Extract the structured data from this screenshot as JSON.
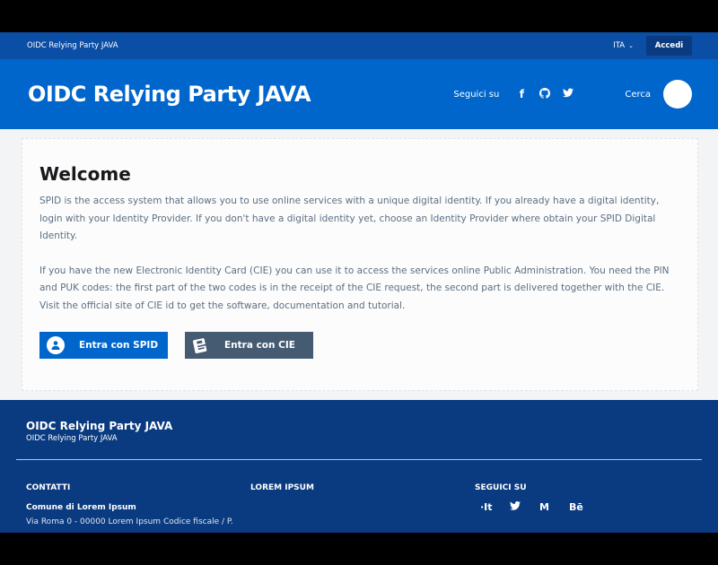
{
  "slim_header": {
    "brand": "OIDC Relying Party JAVA",
    "language": "ITA",
    "login_label": "Accedi"
  },
  "center_header": {
    "title": "OIDC Relying Party JAVA",
    "follow_label": "Seguici su",
    "social_icons": [
      "facebook-icon",
      "github-icon",
      "twitter-icon"
    ],
    "search_label": "Cerca"
  },
  "main": {
    "heading": "Welcome",
    "paragraph_1": "SPID is the access system that allows you to use online services with a unique digital identity. If you already have a digital identity, login with your Identity Provider. If you don't have a digital identity yet, choose an Identity Provider where obtain your SPID Digital Identity.",
    "paragraph_2": "If you have the new Electronic Identity Card (CIE) you can use it to access the services online Public Administration. You need the PIN and PUK codes: the first part of the two codes is in the receipt of the CIE request, the second part is delivered together with the CIE. Visit the official site of CIE id to get the software, documentation and tutorial.",
    "spid_button": "Entra con SPID",
    "cie_button": "Entra con CIE"
  },
  "footer": {
    "title": "OIDC Relying Party JAVA",
    "subtitle": "OIDC Relying Party JAVA",
    "contacts_heading": "CONTATTI",
    "contacts_name": "Comune di Lorem Ipsum",
    "contacts_address": "Via Roma 0 - 00000 Lorem Ipsum Codice fiscale / P.",
    "lorem_heading": "LOREM IPSUM",
    "social_heading": "SEGUICI SU",
    "social_labels": [
      "·It",
      "twitter-icon",
      "M",
      "Bē"
    ]
  },
  "colors": {
    "primary": "#0066cc",
    "header_slim": "#0b4ea6",
    "footer": "#0a3b80",
    "cie_button": "#455b71",
    "text_muted": "#5c6f82"
  }
}
